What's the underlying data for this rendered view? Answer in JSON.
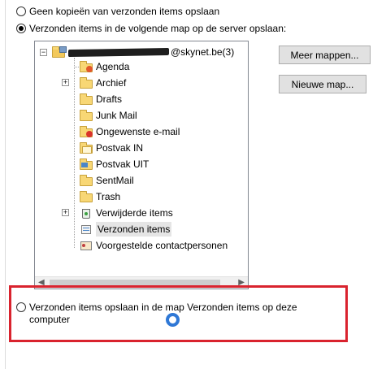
{
  "options": {
    "no_copies_label": "Geen kopieën van verzonden items opslaan",
    "server_folder_label": "Verzonden items in de volgende map op de server opslaan:",
    "local_folder_label": "Verzonden items opslaan in de map Verzonden items op deze computer",
    "selected": "server_folder"
  },
  "tree": {
    "root_label": "@skynet.be(3)",
    "folders": [
      {
        "label": "Agenda",
        "icon": "calendar-folder-icon"
      },
      {
        "label": "Archief",
        "icon": "folder-icon",
        "expandable": true
      },
      {
        "label": "Drafts",
        "icon": "folder-icon"
      },
      {
        "label": "Junk Mail",
        "icon": "folder-icon"
      },
      {
        "label": "Ongewenste e-mail",
        "icon": "junk-mail-folder-icon"
      },
      {
        "label": "Postvak IN",
        "icon": "inbox-folder-icon"
      },
      {
        "label": "Postvak UIT",
        "icon": "outbox-folder-icon"
      },
      {
        "label": "SentMail",
        "icon": "folder-icon"
      },
      {
        "label": "Trash",
        "icon": "folder-icon"
      },
      {
        "label": "Verwijderde items",
        "icon": "recycle-bin-icon",
        "expandable": true
      },
      {
        "label": "Verzonden items",
        "icon": "sent-items-icon",
        "selected": true
      },
      {
        "label": "Voorgestelde contactpersonen",
        "icon": "contacts-folder-icon"
      }
    ]
  },
  "buttons": {
    "more_folders": "Meer mappen...",
    "new_folder": "Nieuwe map..."
  },
  "colors": {
    "highlight_border": "#d9232e",
    "cursor": "#2f78d6",
    "folder": "#f8d775"
  }
}
